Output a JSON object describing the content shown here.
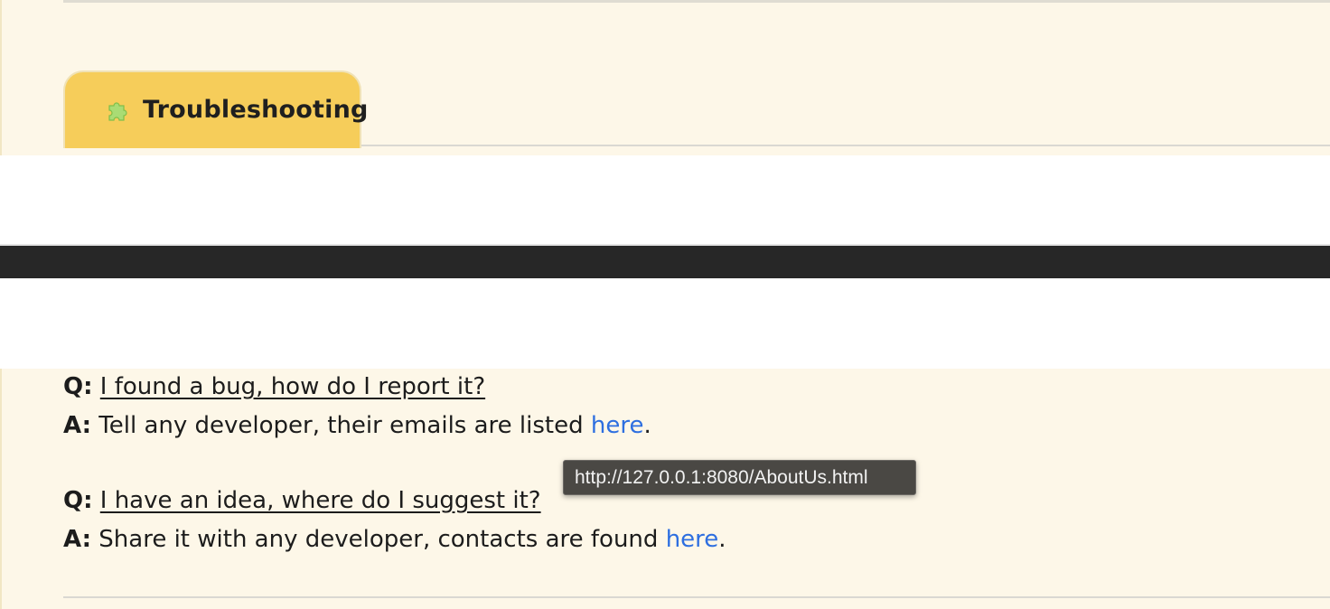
{
  "tabs": [
    {
      "label": "Troubleshooting",
      "icon": "puzzle-piece-icon",
      "active": true
    }
  ],
  "faq": [
    {
      "q_prefix": "Q:",
      "question": "I found a bug, how do I report it?",
      "a_prefix": "A:",
      "answer": "Tell any developer, their emails are listed",
      "link_text": "here",
      "suffix": "."
    },
    {
      "q_prefix": "Q:",
      "question": "I have an idea, where do I suggest it?",
      "a_prefix": "A:",
      "answer": "Share it with any developer, contacts are found",
      "link_text": "here",
      "suffix": "."
    }
  ],
  "tooltip": {
    "text": "http://127.0.0.1:8080/AboutUs.html"
  },
  "colors": {
    "section_bg": "#fdf7e8",
    "tab_bg": "#f6cd5a",
    "link": "#2e6fe0",
    "dark_band": "#272727",
    "tooltip_bg": "#4a4844"
  }
}
